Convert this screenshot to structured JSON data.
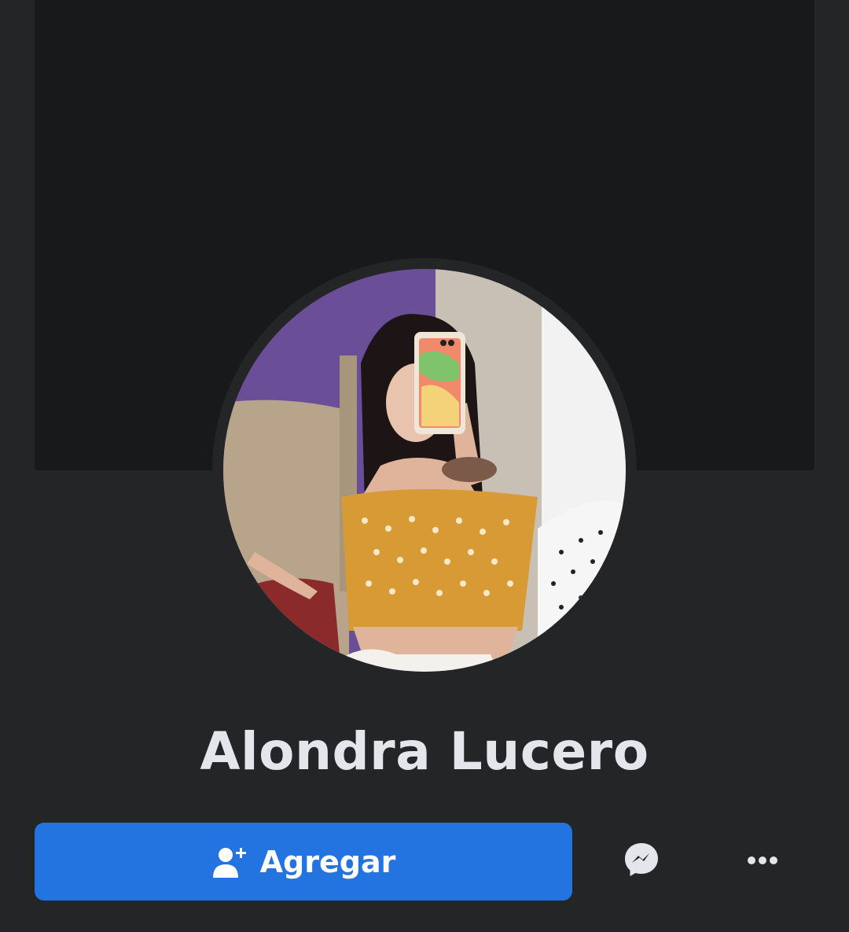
{
  "profile": {
    "name": "Alondra Lucero"
  },
  "actions": {
    "add_label": "Agregar",
    "add_icon": "add-friend-icon",
    "messenger_icon": "messenger-icon",
    "more_icon": "more-dots-icon"
  },
  "colors": {
    "background": "#242526",
    "cover": "#18191a",
    "primary_button": "#2374e1",
    "text": "#e4e6eb"
  }
}
